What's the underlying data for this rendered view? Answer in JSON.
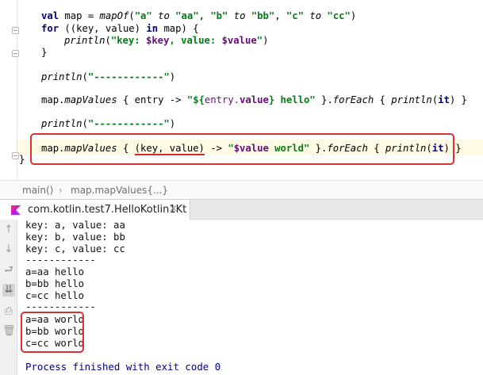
{
  "editor": {
    "lines": {
      "l1": {
        "kw": "val",
        "a": " map = ",
        "fn": "mapOf",
        "b": "(",
        "s1": "\"a\"",
        "to1": " to ",
        "s2": "\"aa\"",
        "c1": ", ",
        "s3": "\"b\"",
        "to2": " to ",
        "s4": "\"bb\"",
        "c2": ", ",
        "s5": "\"c\"",
        "to3": " to ",
        "s6": "\"cc\"",
        "e": ")"
      },
      "l2": {
        "kw": "for",
        "a": " ((key, value) ",
        "kw2": "in",
        "b": " map) {"
      },
      "l3": {
        "fn": "println",
        "a": "(",
        "s1": "\"key: ",
        "t1": "$key",
        "s2": ", value: ",
        "t2": "$value",
        "s3": "\"",
        "b": ")"
      },
      "l4": {
        "a": "}"
      },
      "l5": {
        "fn": "println",
        "a": "(",
        "s": "\"------------\"",
        "b": ")"
      },
      "l6": {
        "a": "map.",
        "fn": "mapValues",
        "b": " { entry -> ",
        "s1": "\"${",
        "t": "entry.",
        "tb": "value",
        "s2": "} hello\"",
        "c": " }.",
        "fn2": "forEach",
        "d": " { ",
        "fn3": "println",
        "e": "(",
        "it": "it",
        "f": ") }"
      },
      "l7": {
        "fn": "println",
        "a": "(",
        "s": "\"------------\"",
        "b": ")"
      },
      "l8": {
        "a": "map.",
        "fn": "mapValues",
        "b": " { ",
        "u": "(key, value)",
        "c": " -> ",
        "s1": "\"",
        "t": "$value",
        "s2": " world\"",
        "d": " }.",
        "fn2": "forEach",
        "e": " { ",
        "fn3": "println",
        "f": "(",
        "it": "it",
        "g": ") }"
      },
      "l9": {
        "a": "}"
      }
    }
  },
  "breadcrumb": {
    "item1": "main()",
    "sep": "›",
    "item2": "map.mapValues{...}"
  },
  "run": {
    "tab_label": "com.kotlin.test7.HelloKotlin1Kt",
    "close": "×",
    "icons": {
      "up": "↑",
      "down": "↓",
      "wrap": "⮐",
      "scroll": "⇊",
      "print": "⎙",
      "trash": "🗑"
    },
    "output": [
      "key: a, value: aa",
      "key: b, value: bb",
      "key: c, value: cc",
      "------------",
      "a=aa hello",
      "b=bb hello",
      "c=cc hello",
      "------------",
      "a=aa world",
      "b=bb world",
      "c=cc world",
      "",
      "Process finished with exit code 0"
    ]
  },
  "colors": {
    "highlight_box": "#d93232",
    "keyword": "#000080",
    "string": "#067d17",
    "template": "#660e7a"
  }
}
